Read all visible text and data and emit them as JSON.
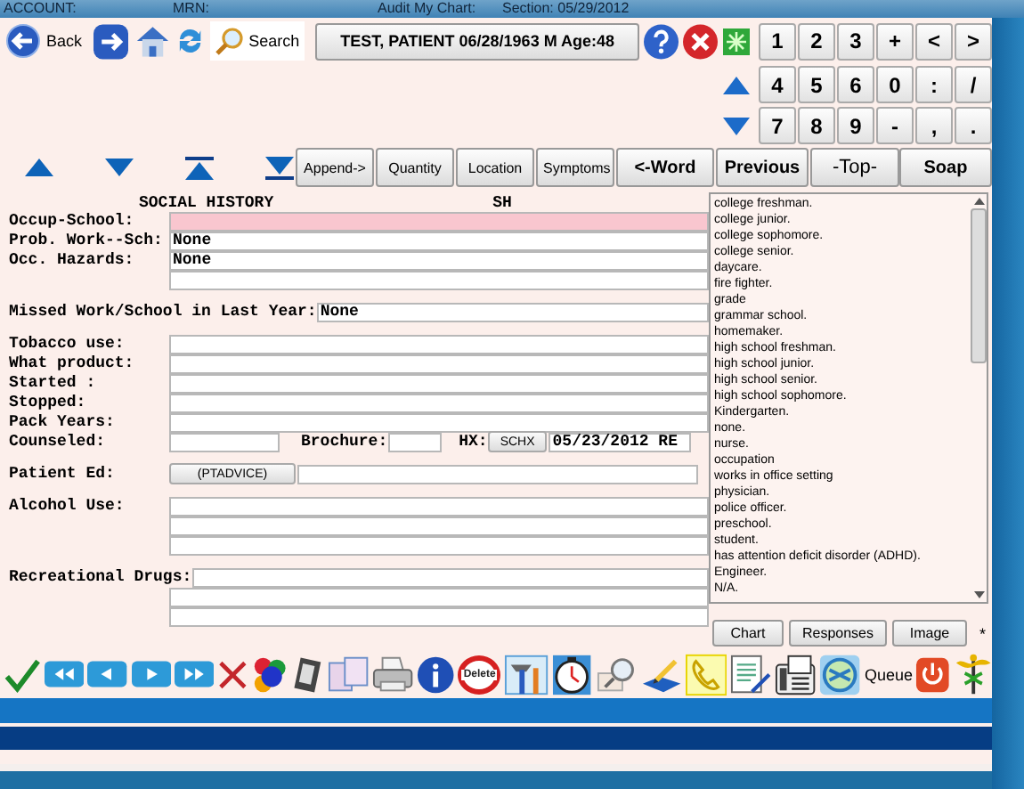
{
  "header": {
    "fields": [
      "ACCOUNT:",
      "MRN:",
      "Audit My Chart:",
      "Section: 05/29/2012"
    ]
  },
  "nav": [
    {
      "kind": "back",
      "label": "Back"
    },
    {
      "kind": "forward"
    },
    {
      "kind": "home"
    },
    {
      "kind": "refresh"
    },
    {
      "kind": "search",
      "label": "Search"
    }
  ],
  "patient_button": "TEST, PATIENT 06/28/1963 M Age:48",
  "keypad": [
    [
      "1",
      "2",
      "3",
      "+",
      "<",
      ">"
    ],
    [
      "4",
      "5",
      "6",
      "0",
      ":",
      "/"
    ],
    [
      "7",
      "8",
      "9",
      "-",
      ",",
      "."
    ]
  ],
  "arrow_buttons": [
    {
      "kind": "up"
    },
    {
      "kind": "down"
    },
    {
      "kind": "top"
    },
    {
      "kind": "bottom"
    }
  ],
  "action_buttons": [
    {
      "label": "Append->",
      "kind": "small"
    },
    {
      "label": "Quantity",
      "kind": "small"
    },
    {
      "label": "Location",
      "kind": "small"
    },
    {
      "label": "Symptoms",
      "kind": "small"
    },
    {
      "label": "<-Word",
      "kind": "bold"
    },
    {
      "label": "Previous",
      "kind": "bold"
    },
    {
      "label": "-Top-",
      "kind": "large"
    },
    {
      "label": "Soap",
      "kind": "bold"
    }
  ],
  "form": {
    "title": "SOCIAL HISTORY",
    "code": "SH",
    "groups": [
      [
        {
          "kind": "field",
          "label": "Occup-School:",
          "highlighted": true
        },
        {
          "kind": "field",
          "label": "Prob. Work--Sch:",
          "value": "None",
          "highlighted": false
        },
        {
          "kind": "field",
          "label": "Occ. Hazards:",
          "value": "None",
          "highlighted": false
        },
        {
          "kind": "field",
          "highlighted": false
        }
      ],
      [
        {
          "kind": "field",
          "label": "Missed Work/School in Last Year:",
          "value": "None",
          "highlighted": false
        }
      ],
      [
        {
          "kind": "field",
          "label": "Tobacco use:",
          "highlighted": false
        },
        {
          "kind": "field",
          "label": "What product:",
          "highlighted": false
        },
        {
          "kind": "field",
          "label": "Started :",
          "highlighted": false
        },
        {
          "kind": "field",
          "label": "Stopped:",
          "highlighted": false
        },
        {
          "kind": "field",
          "label": "Pack Years:",
          "highlighted": false
        },
        {
          "kind": "counseled",
          "label": "Counseled:",
          "brochure_label": "Brochure:",
          "hx_label": "HX:",
          "hx_button": "SCHX",
          "hx_value": "05/23/2012 RE"
        }
      ],
      [
        {
          "kind": "button_field",
          "label": "Patient Ed:",
          "button": "(PTADVICE)"
        }
      ],
      [
        {
          "kind": "field",
          "label": "Alcohol Use:",
          "highlighted": false
        },
        {
          "kind": "field",
          "highlighted": false
        },
        {
          "kind": "field",
          "highlighted": false
        }
      ],
      [
        {
          "kind": "field",
          "label": "Recreational Drugs:",
          "highlighted": false
        },
        {
          "kind": "field",
          "highlighted": false
        },
        {
          "kind": "field",
          "highlighted": false
        }
      ]
    ]
  },
  "responses": [
    "college freshman.",
    "college junior.",
    "college sophomore.",
    "college senior.",
    "daycare.",
    "fire fighter.",
    "grade",
    "grammar school.",
    "homemaker.",
    "high school freshman.",
    "high school junior.",
    "high school senior.",
    "high school sophomore.",
    "Kindergarten.",
    "none.",
    "nurse.",
    "occupation",
    "works in office setting",
    "physician.",
    "police officer.",
    "preschool.",
    "student.",
    "has attention deficit disorder (ADHD).",
    "Engineer.",
    "N/A."
  ],
  "list_buttons": [
    "Chart",
    "Responses",
    "Image"
  ],
  "asterisk": "*",
  "bottom_toolbar": [
    {
      "kind": "check"
    },
    {
      "kind": "first"
    },
    {
      "kind": "prev"
    },
    {
      "kind": "next"
    },
    {
      "kind": "last"
    },
    {
      "kind": "cancel"
    },
    {
      "kind": "circles"
    },
    {
      "kind": "notebook"
    },
    {
      "kind": "windows"
    },
    {
      "kind": "printer"
    },
    {
      "kind": "info"
    },
    {
      "kind": "delete",
      "label": "Delete"
    },
    {
      "kind": "tools"
    },
    {
      "kind": "clock"
    },
    {
      "kind": "magnifier"
    },
    {
      "kind": "pencil"
    },
    {
      "kind": "phone"
    },
    {
      "kind": "document"
    },
    {
      "kind": "fax"
    },
    {
      "kind": "disc"
    },
    {
      "kind": "queue",
      "label": "Queue"
    },
    {
      "kind": "power"
    },
    {
      "kind": "caduceus"
    }
  ]
}
